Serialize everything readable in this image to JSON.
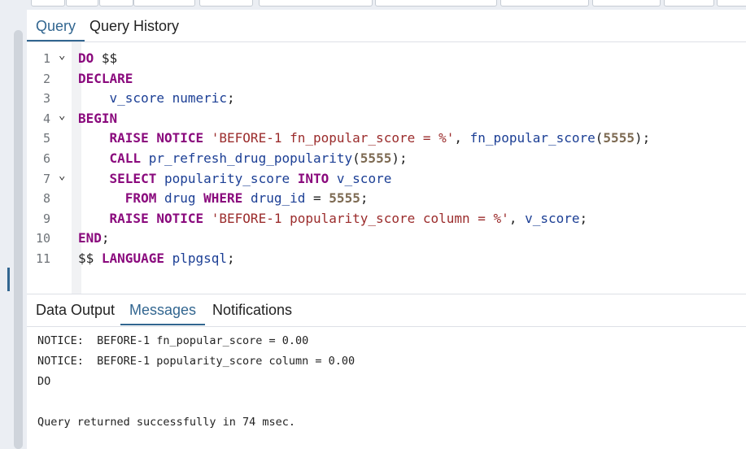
{
  "query_tabs": [
    {
      "label": "Query",
      "active": true
    },
    {
      "label": "Query History",
      "active": false
    }
  ],
  "editor": {
    "lines": [
      {
        "n": "1",
        "fold": true,
        "tokens": [
          [
            "kw",
            "DO"
          ],
          [
            "pl",
            " $$"
          ]
        ]
      },
      {
        "n": "2",
        "fold": false,
        "tokens": [
          [
            "kw",
            "DECLARE"
          ]
        ]
      },
      {
        "n": "3",
        "fold": false,
        "tokens": [
          [
            "pl",
            "    "
          ],
          [
            "id",
            "v_score"
          ],
          [
            "pl",
            " "
          ],
          [
            "id",
            "numeric"
          ],
          [
            "pl",
            ";"
          ]
        ]
      },
      {
        "n": "4",
        "fold": true,
        "tokens": [
          [
            "kw",
            "BEGIN"
          ]
        ]
      },
      {
        "n": "5",
        "fold": false,
        "tokens": [
          [
            "pl",
            "    "
          ],
          [
            "kw",
            "RAISE NOTICE"
          ],
          [
            "pl",
            " "
          ],
          [
            "str",
            "'BEFORE-1 fn_popular_score = %'"
          ],
          [
            "pl",
            ", "
          ],
          [
            "id",
            "fn_popular_score"
          ],
          [
            "pl",
            "("
          ],
          [
            "num",
            "5555"
          ],
          [
            "pl",
            ");"
          ]
        ]
      },
      {
        "n": "6",
        "fold": false,
        "tokens": [
          [
            "pl",
            "    "
          ],
          [
            "kw",
            "CALL"
          ],
          [
            "pl",
            " "
          ],
          [
            "id",
            "pr_refresh_drug_popularity"
          ],
          [
            "pl",
            "("
          ],
          [
            "num",
            "5555"
          ],
          [
            "pl",
            ");"
          ]
        ]
      },
      {
        "n": "7",
        "fold": true,
        "tokens": [
          [
            "pl",
            "    "
          ],
          [
            "kw",
            "SELECT"
          ],
          [
            "pl",
            " "
          ],
          [
            "id",
            "popularity_score"
          ],
          [
            "pl",
            " "
          ],
          [
            "kw",
            "INTO"
          ],
          [
            "pl",
            " "
          ],
          [
            "id",
            "v_score"
          ]
        ]
      },
      {
        "n": "8",
        "fold": false,
        "tokens": [
          [
            "pl",
            "      "
          ],
          [
            "kw",
            "FROM"
          ],
          [
            "pl",
            " "
          ],
          [
            "id",
            "drug"
          ],
          [
            "pl",
            " "
          ],
          [
            "kw",
            "WHERE"
          ],
          [
            "pl",
            " "
          ],
          [
            "id",
            "drug_id"
          ],
          [
            "pl",
            " = "
          ],
          [
            "num",
            "5555"
          ],
          [
            "pl",
            ";"
          ]
        ]
      },
      {
        "n": "9",
        "fold": false,
        "tokens": [
          [
            "pl",
            "    "
          ],
          [
            "kw",
            "RAISE NOTICE"
          ],
          [
            "pl",
            " "
          ],
          [
            "str",
            "'BEFORE-1 popularity_score column = %'"
          ],
          [
            "pl",
            ", "
          ],
          [
            "id",
            "v_score"
          ],
          [
            "pl",
            ";"
          ]
        ]
      },
      {
        "n": "10",
        "fold": false,
        "tokens": [
          [
            "kw",
            "END"
          ],
          [
            "pl",
            ";"
          ]
        ]
      },
      {
        "n": "11",
        "fold": false,
        "tokens": [
          [
            "pl",
            "$$ "
          ],
          [
            "kw",
            "LANGUAGE"
          ],
          [
            "pl",
            " "
          ],
          [
            "id",
            "plpgsql"
          ],
          [
            "pl",
            ";"
          ]
        ]
      }
    ]
  },
  "output_tabs": [
    {
      "label": "Data Output",
      "active": false
    },
    {
      "label": "Messages",
      "active": true
    },
    {
      "label": "Notifications",
      "active": false
    }
  ],
  "messages": [
    "NOTICE:  BEFORE-1 fn_popular_score = 0.00",
    "NOTICE:  BEFORE-1 popularity_score column = 0.00",
    "DO",
    "",
    "Query returned successfully in 74 msec."
  ],
  "colors": {
    "accent": "#326690",
    "keyword": "#8a0a7d",
    "identifier": "#1c3f95",
    "string": "#9b2c2c",
    "number": "#7d6a52"
  }
}
